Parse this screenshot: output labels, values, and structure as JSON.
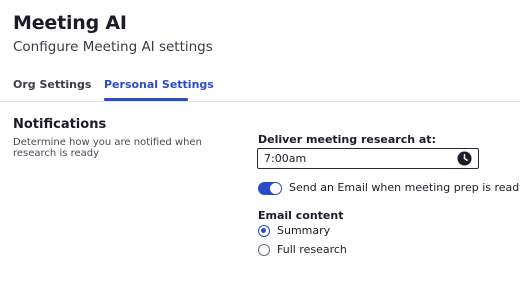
{
  "header": {
    "title": "Meeting AI",
    "subtitle": "Configure Meeting AI settings"
  },
  "tabs": [
    {
      "label": "Org Settings",
      "active": false
    },
    {
      "label": "Personal Settings",
      "active": true
    }
  ],
  "notifications": {
    "title": "Notifications",
    "description": "Determine how you are notified when research is ready",
    "deliver_label": "Deliver meeting research at:",
    "time_value": "7:00am",
    "email_toggle": {
      "label": "Send an Email when meeting prep is ready",
      "on": true
    },
    "email_content_label": "Email content",
    "options": [
      {
        "label": "Summary",
        "selected": true
      },
      {
        "label": "Full research",
        "selected": false
      }
    ]
  },
  "colors": {
    "accent": "#2b4cc8",
    "text": "#1c1c28",
    "divider": "#e3e3e8"
  },
  "icons": {
    "time_input": "clock-icon"
  }
}
